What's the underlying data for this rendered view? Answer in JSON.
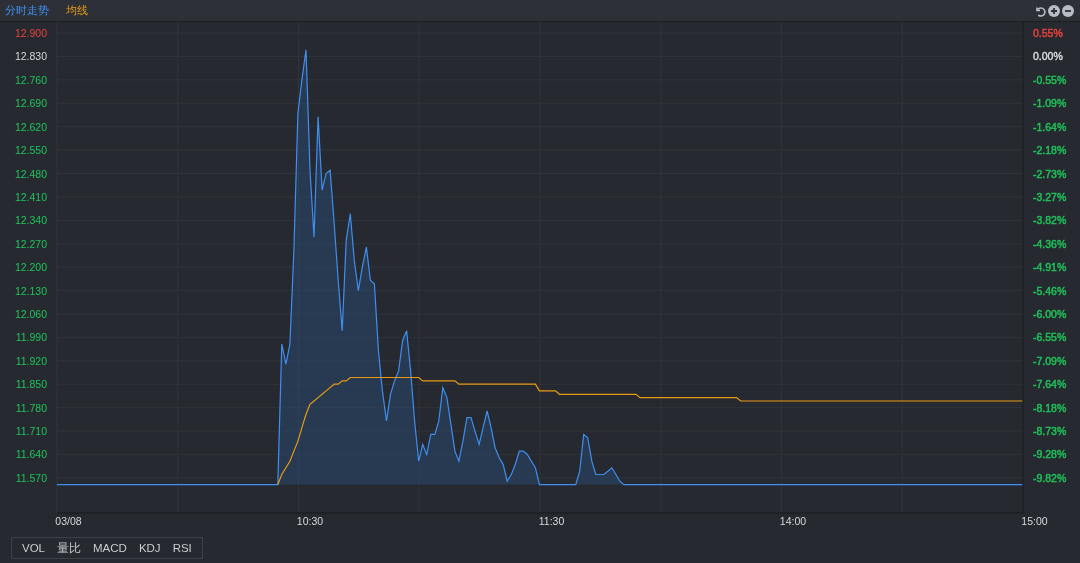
{
  "chart_data": {
    "type": "line",
    "categories": [
      "03/08",
      null,
      null,
      null,
      null,
      null,
      null,
      null,
      null,
      null,
      null,
      null,
      null,
      null,
      null,
      null,
      null,
      null,
      null,
      null,
      null,
      null,
      null,
      null,
      null,
      null,
      null,
      null,
      null,
      null,
      null,
      null,
      null,
      null,
      null,
      null,
      null,
      null,
      null,
      null,
      null,
      null,
      null,
      null,
      null,
      null,
      null,
      null,
      null,
      null,
      null,
      null,
      null,
      null,
      null,
      null,
      null,
      null,
      null,
      null,
      "10:30",
      null,
      null,
      null,
      null,
      null,
      null,
      null,
      null,
      null,
      null,
      null,
      null,
      null,
      null,
      null,
      null,
      null,
      null,
      null,
      null,
      null,
      null,
      null,
      null,
      null,
      null,
      null,
      null,
      null,
      null,
      null,
      null,
      null,
      null,
      null,
      null,
      null,
      null,
      null,
      null,
      null,
      null,
      null,
      null,
      null,
      null,
      null,
      null,
      null,
      null,
      null,
      null,
      null,
      null,
      null,
      null,
      null,
      null,
      null,
      "11:30",
      null,
      null,
      null,
      null,
      null,
      null,
      null,
      null,
      null,
      null,
      null,
      null,
      null,
      null,
      null,
      null,
      null,
      null,
      null,
      null,
      null,
      null,
      null,
      null,
      null,
      null,
      null,
      null,
      null,
      null,
      null,
      null,
      null,
      null,
      null,
      null,
      null,
      null,
      null,
      null,
      null,
      null,
      null,
      null,
      null,
      null,
      null,
      null,
      null,
      null,
      null,
      null,
      null,
      null,
      null,
      null,
      null,
      null,
      null,
      "14:00",
      null,
      null,
      null,
      null,
      null,
      null,
      null,
      null,
      null,
      null,
      null,
      null,
      null,
      null,
      null,
      null,
      null,
      null,
      null,
      null,
      null,
      null,
      null,
      null,
      null,
      null,
      null,
      null,
      null,
      null,
      null,
      null,
      null,
      null,
      null,
      null,
      null,
      null,
      null,
      null,
      null,
      null,
      null,
      null,
      null,
      null,
      null,
      null,
      null,
      null,
      null,
      null,
      null,
      null,
      null,
      null,
      null,
      null,
      null,
      "15:00"
    ],
    "ylim": [
      11.465,
      12.933
    ],
    "yticks": [
      {
        "value": 12.9,
        "label": "12.900"
      },
      {
        "value": 12.83,
        "label": "12.830"
      },
      {
        "value": 12.76,
        "label": "12.760"
      },
      {
        "value": 12.69,
        "label": "12.690"
      },
      {
        "value": 12.62,
        "label": "12.620"
      },
      {
        "value": 12.55,
        "label": "12.550"
      },
      {
        "value": 12.48,
        "label": "12.480"
      },
      {
        "value": 12.41,
        "label": "12.410"
      },
      {
        "value": 12.34,
        "label": "12.340"
      },
      {
        "value": 12.27,
        "label": "12.270"
      },
      {
        "value": 12.2,
        "label": "12.200"
      },
      {
        "value": 12.13,
        "label": "12.130"
      },
      {
        "value": 12.06,
        "label": "12.060"
      },
      {
        "value": 11.99,
        "label": "11.990"
      },
      {
        "value": 11.92,
        "label": "11.920"
      },
      {
        "value": 11.85,
        "label": "11.850"
      },
      {
        "value": 11.78,
        "label": "11.780"
      },
      {
        "value": 11.71,
        "label": "11.710"
      },
      {
        "value": 11.64,
        "label": "11.640"
      },
      {
        "value": 11.57,
        "label": "11.570"
      }
    ],
    "grid": true,
    "series": [
      {
        "name": "分时走势",
        "color": "#3f8ef0",
        "values": [
          11.55,
          11.55,
          11.55,
          11.55,
          11.55,
          11.55,
          11.55,
          11.55,
          11.55,
          11.55,
          11.55,
          11.55,
          11.55,
          11.55,
          11.55,
          11.55,
          11.55,
          11.55,
          11.55,
          11.55,
          11.55,
          11.55,
          11.55,
          11.55,
          11.55,
          11.55,
          11.55,
          11.55,
          11.55,
          11.55,
          11.55,
          11.55,
          11.55,
          11.55,
          11.55,
          11.55,
          11.55,
          11.55,
          11.55,
          11.55,
          11.55,
          11.55,
          11.55,
          11.55,
          11.55,
          11.55,
          11.55,
          11.55,
          11.55,
          11.55,
          11.55,
          11.55,
          11.55,
          11.97,
          11.91,
          11.97,
          12.25,
          12.66,
          12.76,
          12.85,
          12.49,
          12.29,
          12.65,
          12.43,
          12.48,
          12.49,
          12.33,
          12.16,
          12.01,
          12.28,
          12.36,
          12.22,
          12.13,
          12.2,
          12.26,
          12.16,
          12.15,
          11.95,
          11.83,
          11.74,
          11.82,
          11.86,
          11.89,
          11.98,
          12.01,
          11.89,
          11.74,
          11.62,
          11.67,
          11.64,
          11.7,
          11.7,
          11.74,
          11.84,
          11.81,
          11.73,
          11.65,
          11.62,
          11.68,
          11.75,
          11.75,
          11.71,
          11.67,
          11.72,
          11.77,
          11.72,
          11.66,
          11.63,
          11.61,
          11.56,
          11.58,
          11.61,
          11.65,
          11.65,
          11.64,
          11.62,
          11.6,
          11.55,
          11.55,
          11.55,
          11.55,
          11.55,
          11.55,
          11.55,
          11.55,
          11.55,
          11.55,
          11.59,
          11.7,
          11.69,
          11.62,
          11.58,
          11.58,
          11.58,
          11.59,
          11.6,
          11.58,
          11.56,
          11.55,
          11.55,
          11.55,
          11.55,
          11.55,
          11.55,
          11.55,
          11.55,
          11.55,
          11.55,
          11.55,
          11.55,
          11.55,
          11.55,
          11.55,
          11.55,
          11.55,
          11.55,
          11.55,
          11.55,
          11.55,
          11.55,
          11.55,
          11.55,
          11.55,
          11.55,
          11.55,
          11.55,
          11.55,
          11.55,
          11.55,
          11.55,
          11.55,
          11.55,
          11.55,
          11.55,
          11.55,
          11.55,
          11.55,
          11.55,
          11.55,
          11.55,
          11.55,
          11.55,
          11.55,
          11.55,
          11.55,
          11.55,
          11.55,
          11.55,
          11.55,
          11.55,
          11.55,
          11.55,
          11.55,
          11.55,
          11.55,
          11.55,
          11.55,
          11.55,
          11.55,
          11.55,
          11.55,
          11.55,
          11.55,
          11.55,
          11.55,
          11.55,
          11.55,
          11.55,
          11.55,
          11.55,
          11.55,
          11.55,
          11.55,
          11.55,
          11.55,
          11.55,
          11.55,
          11.55,
          11.55,
          11.55,
          11.55,
          11.55,
          11.55,
          11.55,
          11.55,
          11.55,
          11.55,
          11.55,
          11.55,
          11.55,
          11.55,
          11.55,
          11.55,
          11.55,
          11.55,
          11.55,
          11.55,
          11.55,
          null,
          null,
          null
        ]
      },
      {
        "name": "均线",
        "color": "#e89a14",
        "values": [
          null,
          null,
          null,
          null,
          null,
          null,
          null,
          null,
          null,
          null,
          null,
          null,
          null,
          null,
          null,
          null,
          null,
          null,
          null,
          null,
          null,
          null,
          null,
          null,
          null,
          null,
          null,
          null,
          null,
          null,
          null,
          null,
          null,
          null,
          null,
          null,
          null,
          null,
          null,
          null,
          null,
          null,
          null,
          null,
          null,
          null,
          null,
          null,
          null,
          null,
          null,
          null,
          11.55,
          11.58,
          11.6,
          11.62,
          11.65,
          11.68,
          11.72,
          11.76,
          11.79,
          11.8,
          11.81,
          11.82,
          11.83,
          11.84,
          11.85,
          11.85,
          11.86,
          11.86,
          11.87,
          11.87,
          11.87,
          11.87,
          11.87,
          11.87,
          11.87,
          11.87,
          11.87,
          11.87,
          11.87,
          11.87,
          11.87,
          11.87,
          11.87,
          11.87,
          11.87,
          11.87,
          11.86,
          11.86,
          11.86,
          11.86,
          11.86,
          11.86,
          11.86,
          11.86,
          11.86,
          11.85,
          11.85,
          11.85,
          11.85,
          11.85,
          11.85,
          11.85,
          11.85,
          11.85,
          11.85,
          11.85,
          11.85,
          11.85,
          11.85,
          11.85,
          11.85,
          11.85,
          11.85,
          11.85,
          11.85,
          11.83,
          11.83,
          11.83,
          11.83,
          11.83,
          11.82,
          11.82,
          11.82,
          11.82,
          11.82,
          11.82,
          11.82,
          11.82,
          11.82,
          11.82,
          11.82,
          11.82,
          11.82,
          11.82,
          11.82,
          11.82,
          11.82,
          11.82,
          11.82,
          11.82,
          11.81,
          11.81,
          11.81,
          11.81,
          11.81,
          11.81,
          11.81,
          11.81,
          11.81,
          11.81,
          11.81,
          11.81,
          11.81,
          11.81,
          11.81,
          11.81,
          11.81,
          11.81,
          11.81,
          11.81,
          11.81,
          11.81,
          11.81,
          11.81,
          11.81,
          11.8,
          11.8,
          11.8,
          11.8,
          11.8,
          11.8,
          11.8,
          11.8,
          11.8,
          11.8,
          11.8,
          11.8,
          11.8,
          11.8,
          11.8,
          11.8,
          11.8,
          11.8,
          11.8,
          11.8,
          11.8,
          11.8,
          11.8,
          11.8,
          11.8,
          11.8,
          11.8,
          11.8,
          11.8,
          11.8,
          11.8,
          11.8,
          11.8,
          11.8,
          11.8,
          11.8,
          11.8,
          11.8,
          11.8,
          11.8,
          11.8,
          11.8,
          11.8,
          11.8,
          11.8,
          11.8,
          11.8,
          11.8,
          11.8,
          11.8,
          11.8,
          11.8,
          11.8,
          11.8,
          11.8,
          11.8,
          11.8,
          11.8,
          11.8,
          11.8,
          11.8,
          11.8,
          11.8,
          11.8,
          11.8,
          11.8,
          11.8,
          11.8,
          11.8,
          11.8,
          11.8,
          null,
          null,
          null
        ]
      }
    ]
  },
  "percent_axis": [
    {
      "label": "0.55%",
      "color": "#e8413c"
    },
    {
      "label": "0.00%",
      "color": "#d5d9de"
    },
    {
      "label": "-0.55%",
      "color": "#1fc35a"
    },
    {
      "label": "-1.09%",
      "color": "#1fc35a"
    },
    {
      "label": "-1.64%",
      "color": "#1fc35a"
    },
    {
      "label": "-2.18%",
      "color": "#1fc35a"
    },
    {
      "label": "-2.73%",
      "color": "#1fc35a"
    },
    {
      "label": "-3.27%",
      "color": "#1fc35a"
    },
    {
      "label": "-3.82%",
      "color": "#1fc35a"
    },
    {
      "label": "-4.36%",
      "color": "#1fc35a"
    },
    {
      "label": "-4.91%",
      "color": "#1fc35a"
    },
    {
      "label": "-5.46%",
      "color": "#1fc35a"
    },
    {
      "label": "-6.00%",
      "color": "#1fc35a"
    },
    {
      "label": "-6.55%",
      "color": "#1fc35a"
    },
    {
      "label": "-7.09%",
      "color": "#1fc35a"
    },
    {
      "label": "-7.64%",
      "color": "#1fc35a"
    },
    {
      "label": "-8.18%",
      "color": "#1fc35a"
    },
    {
      "label": "-8.73%",
      "color": "#1fc35a"
    },
    {
      "label": "-9.28%",
      "color": "#1fc35a"
    },
    {
      "label": "-9.82%",
      "color": "#1fc35a"
    }
  ],
  "indicator_tabs": [
    "VOL",
    "量比",
    "MACD",
    "KDJ",
    "RSI"
  ]
}
